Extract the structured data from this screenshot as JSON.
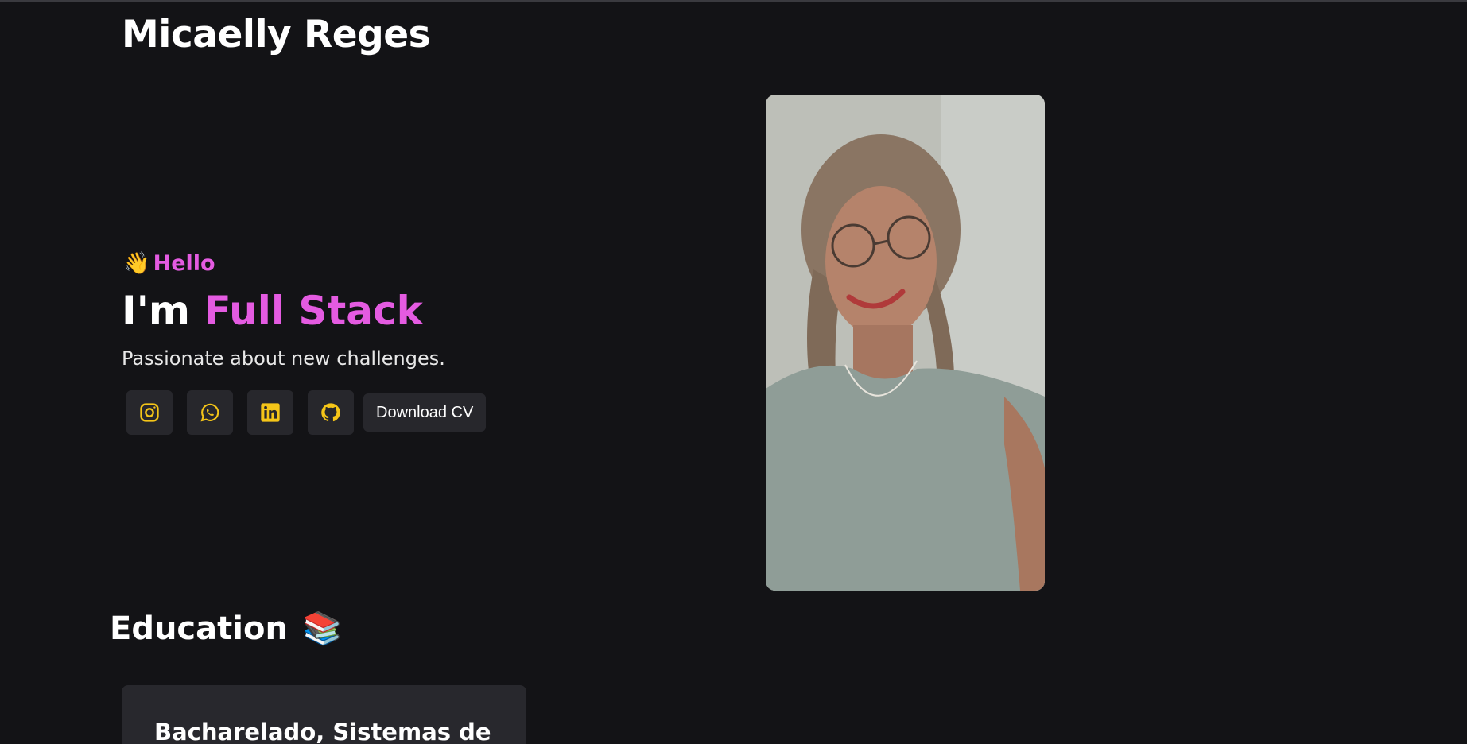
{
  "header": {
    "name": "Micaelly Reges"
  },
  "hero": {
    "greeting_icon": "👋",
    "greeting": "Hello",
    "headline_prefix": "I'm",
    "headline_role": "Full Stack",
    "tagline": "Passionate about new challenges.",
    "socials": [
      {
        "icon": "instagram-icon"
      },
      {
        "icon": "whatsapp-icon"
      },
      {
        "icon": "linkedin-icon"
      },
      {
        "icon": "github-icon"
      }
    ],
    "cv_button": "Download CV"
  },
  "profile_photo": {
    "icon": "profile-photo"
  },
  "education": {
    "title": "Education",
    "title_icon": "📚",
    "items": [
      {
        "title": "Bacharelado, Sistemas de"
      }
    ]
  },
  "colors": {
    "background": "#131316",
    "accent": "#e45be1",
    "icon": "#f5c518",
    "button_bg": "#27272c",
    "card_bg": "#28282d"
  }
}
